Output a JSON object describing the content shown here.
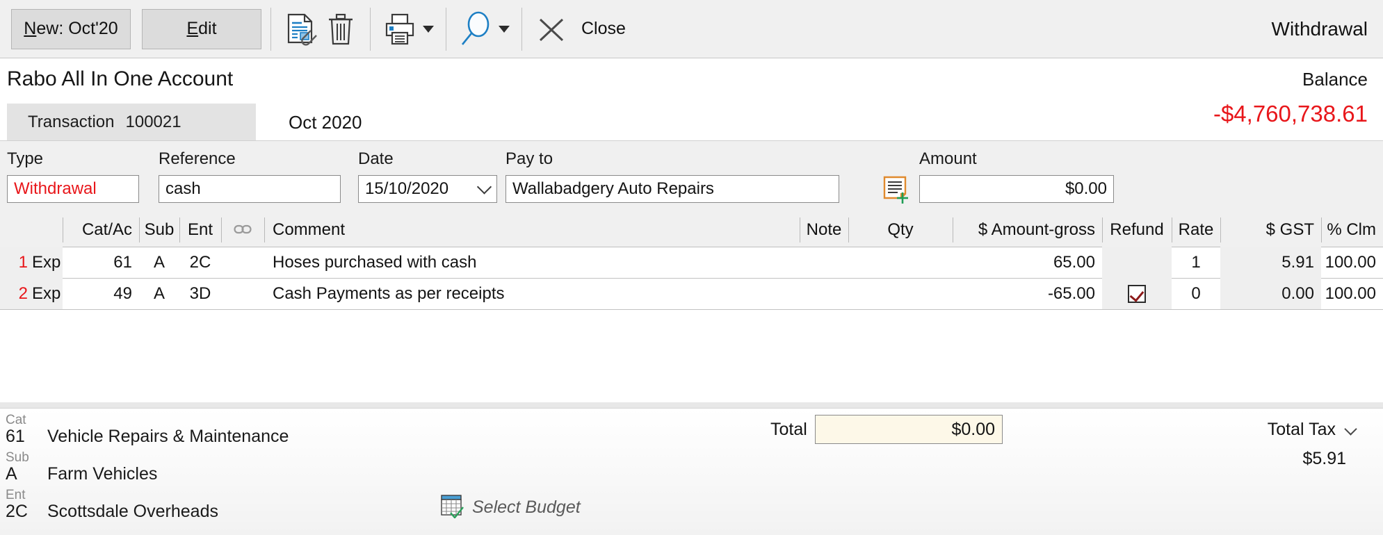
{
  "toolbar": {
    "new_button": {
      "prefix": "N",
      "rest": "ew: Oct'20"
    },
    "edit_button": {
      "prefix": "E",
      "rest": "dit"
    },
    "attach_icon": "document-attachment-icon",
    "delete_icon": "trash-icon",
    "print_icon": "printer-icon",
    "print_dropdown_icon": "chevron-down-icon",
    "search_icon": "magnifier-icon",
    "search_dropdown_icon": "chevron-down-icon",
    "close_icon": "close-x-icon",
    "close_label": "Close",
    "window_title": "Withdrawal"
  },
  "header": {
    "account_name": "Rabo All In One Account",
    "balance_label": "Balance",
    "balance_value": "-$4,760,738.61",
    "balance_color": "#e8161a",
    "tab_label": "Transaction",
    "tab_number": "100021",
    "period": "Oct 2020"
  },
  "fields": {
    "type": {
      "label": "Type",
      "value": "Withdrawal"
    },
    "reference": {
      "label": "Reference",
      "value": "cash"
    },
    "date": {
      "label": "Date",
      "value": "15/10/2020"
    },
    "payto": {
      "label": "Pay to",
      "value": "Wallabadgery Auto Repairs"
    },
    "note_add_icon": "add-note-icon",
    "amount": {
      "label": "Amount",
      "value": "$0.00"
    }
  },
  "grid": {
    "headers": {
      "rownum": "",
      "catac": "Cat/Ac",
      "sub": "Sub",
      "ent": "Ent",
      "link": "link-icon",
      "comment": "Comment",
      "note": "Note",
      "qty": "Qty",
      "amount_gross": "$ Amount-gross",
      "refund": "Refund",
      "rate": "Rate",
      "gst": "$ GST",
      "pct_clm": "% Clm"
    },
    "rows": [
      {
        "num": "1",
        "type": "Exp",
        "catac": "61",
        "sub": "A",
        "ent": "2C",
        "comment": "Hoses purchased with cash",
        "note": "",
        "qty": "",
        "amount_gross": "65.00",
        "refund": false,
        "rate": "1",
        "gst": "5.91",
        "pct_clm": "100.00"
      },
      {
        "num": "2",
        "type": "Exp",
        "catac": "49",
        "sub": "A",
        "ent": "3D",
        "comment": "Cash Payments as per receipts",
        "note": "",
        "qty": "",
        "amount_gross": "-65.00",
        "refund": true,
        "rate": "0",
        "gst": "0.00",
        "pct_clm": "100.00"
      }
    ]
  },
  "footer": {
    "cat": {
      "label": "Cat",
      "code": "61",
      "description": "Vehicle Repairs & Maintenance"
    },
    "sub": {
      "label": "Sub",
      "code": "A",
      "description": "Farm Vehicles"
    },
    "ent": {
      "label": "Ent",
      "code": "2C",
      "description": "Scottsdale Overheads"
    },
    "total_label": "Total",
    "total_value": "$0.00",
    "total_tax_label": "Total Tax",
    "total_tax_value": "$5.91",
    "select_budget_icon": "budget-table-icon",
    "select_budget_label": "Select Budget"
  }
}
